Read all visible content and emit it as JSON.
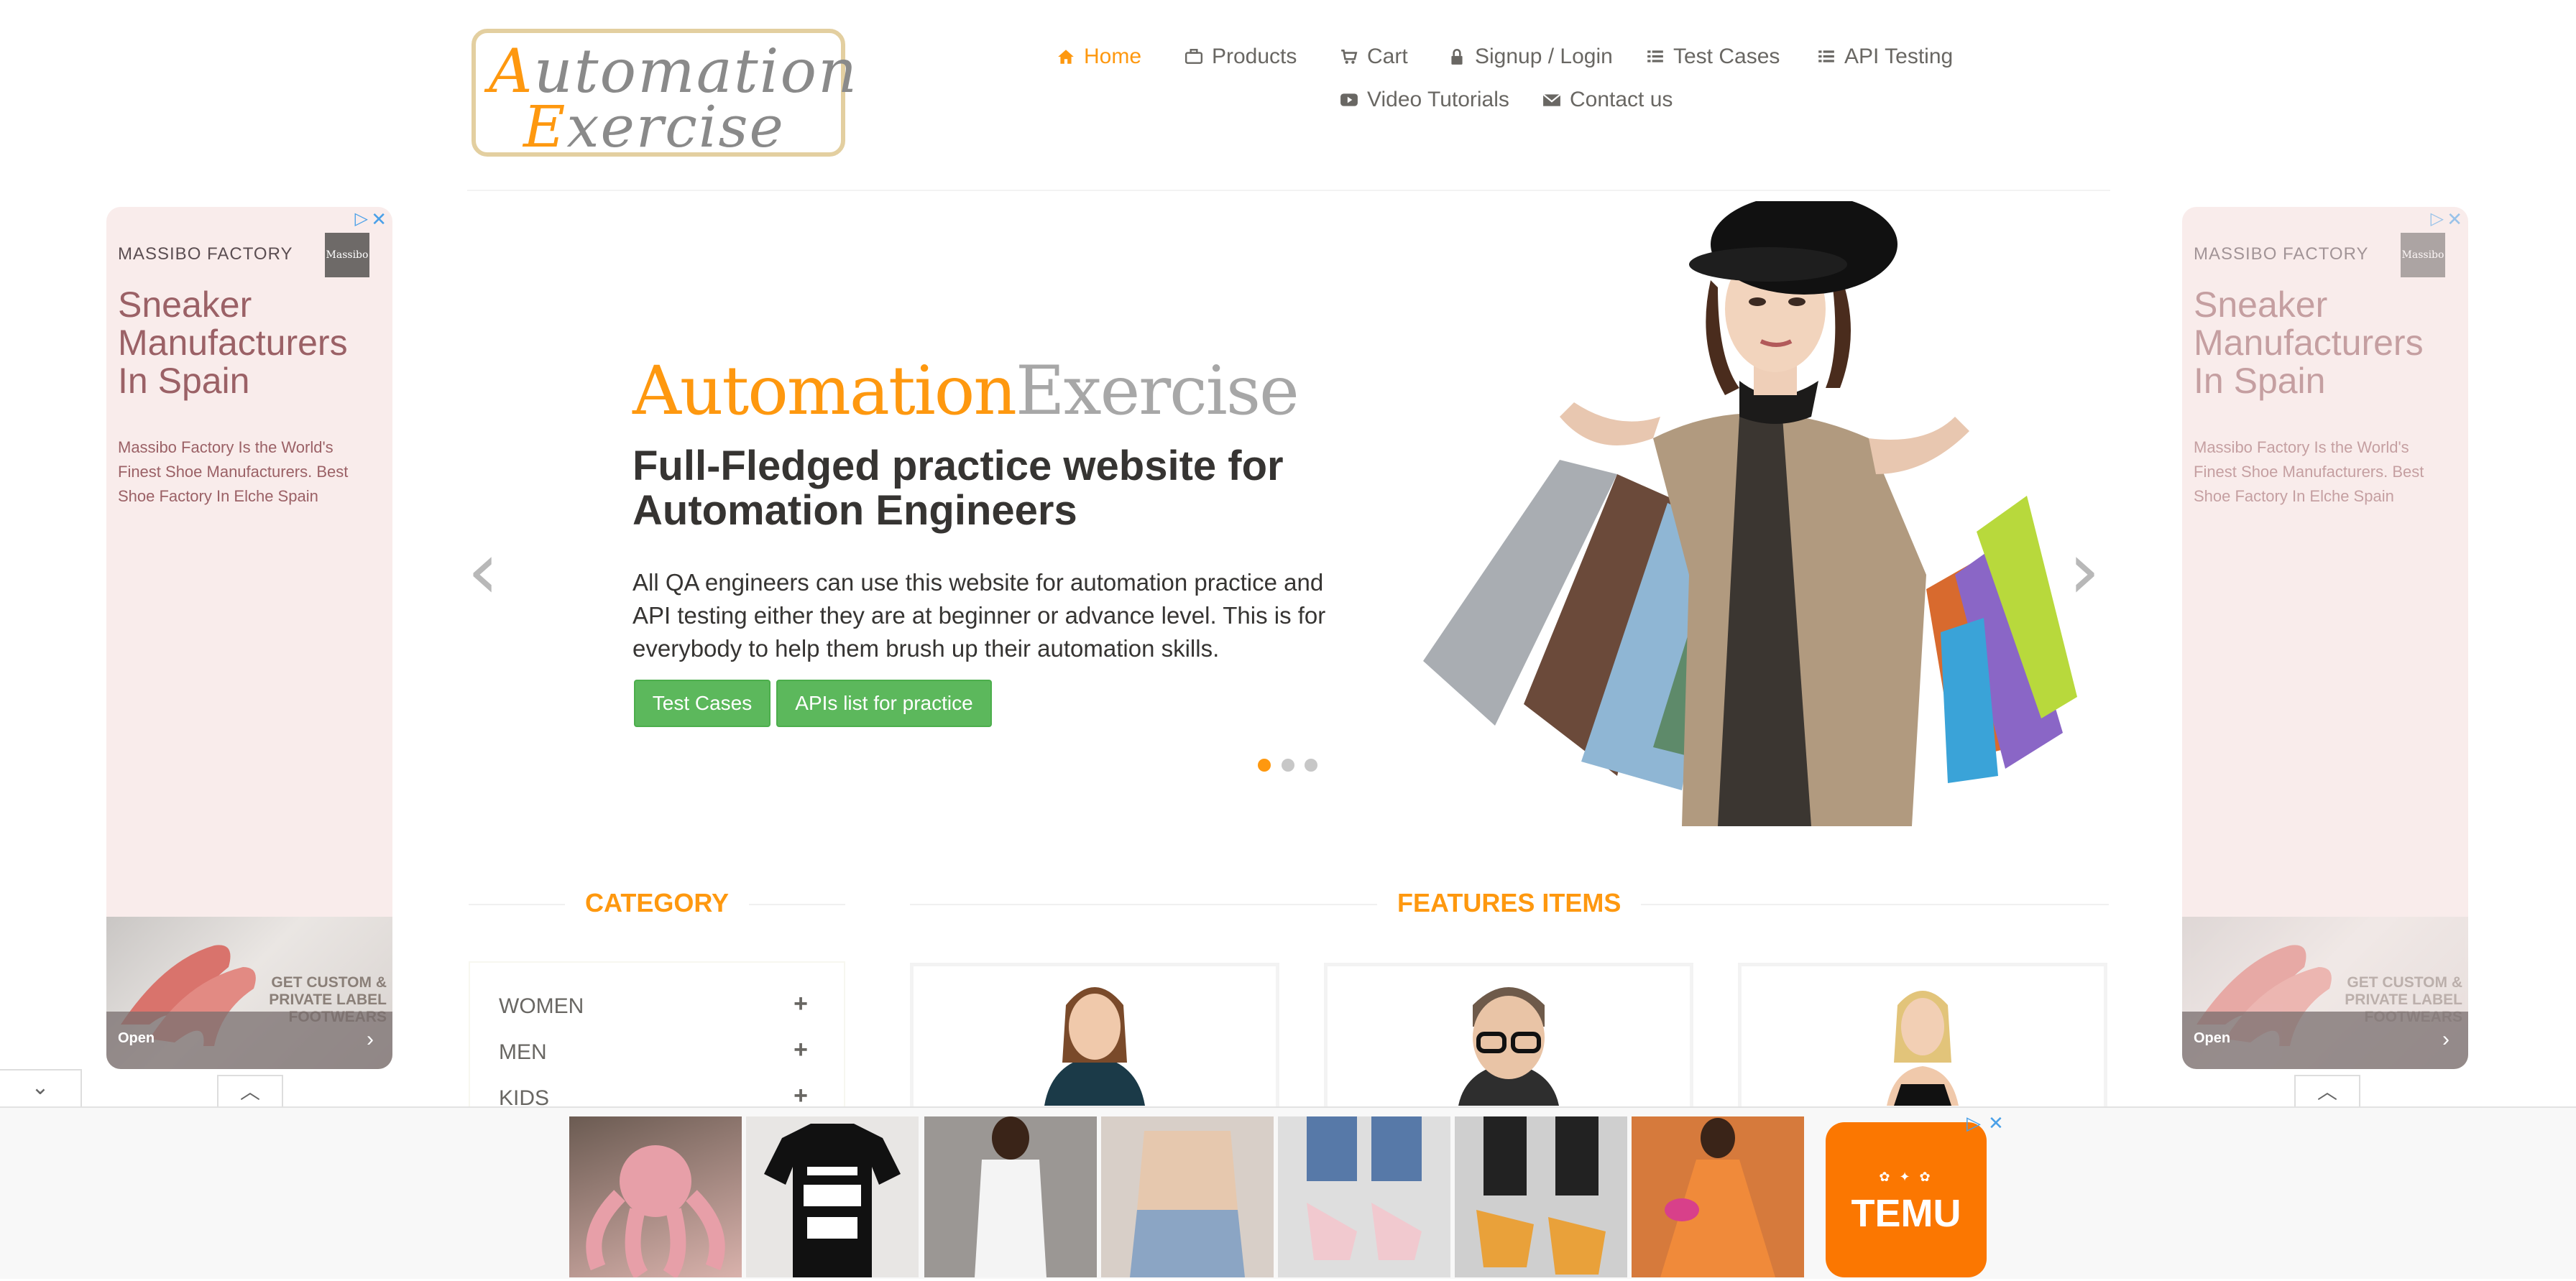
{
  "logo": {
    "line1": "Automation",
    "line2": "Exercise",
    "cap1": "A",
    "cap2": "E",
    "rest1": "utomation",
    "rest2": "xercise"
  },
  "nav": {
    "home": "Home",
    "products": "Products",
    "cart": "Cart",
    "signup": "Signup / Login",
    "test_cases": "Test Cases",
    "api_testing": "API Testing",
    "video": "Video Tutorials",
    "contact": "Contact us"
  },
  "side_ad": {
    "brand": "MASSIBO FACTORY",
    "logo_text": "Massibo",
    "title": "Sneaker Manufacturers In Spain",
    "desc": "Massibo Factory Is the World's Finest Shoe Manufacturers. Best Shoe Factory In Elche Spain",
    "image_text": "GET CUSTOM & PRIVATE LABEL FOOTWEARS",
    "open": "Open"
  },
  "hero": {
    "title_a": "Automation",
    "title_b": "Exercise",
    "heading": "Full-Fledged practice website for Automation Engineers",
    "paragraph": "All QA engineers can use this website for automation practice and API testing either they are at beginner or advance level. This is for everybody to help them brush up their automation skills.",
    "btn_test_cases": "Test Cases",
    "btn_apis": "APIs list for practice",
    "slide_active": 1,
    "slide_count": 3
  },
  "category": {
    "title": "CATEGORY",
    "items": [
      "WOMEN",
      "MEN",
      "KIDS"
    ]
  },
  "features": {
    "title": "FEATURES ITEMS"
  },
  "bottom_ad": {
    "brand": "TEMU"
  },
  "colors": {
    "accent": "#fe980f",
    "button": "#5cb85c",
    "text": "#696763",
    "dark": "#363432"
  }
}
